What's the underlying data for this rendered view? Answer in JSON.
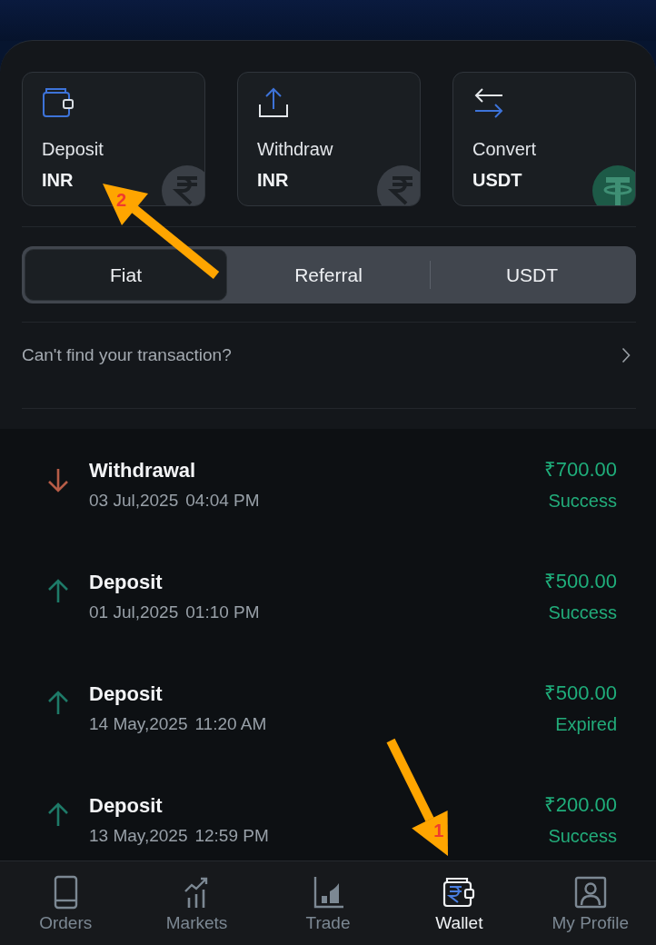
{
  "actions": [
    {
      "kind": "deposit",
      "label": "Deposit",
      "currency": "INR",
      "callout": "2"
    },
    {
      "kind": "withdraw",
      "label": "Withdraw",
      "currency": "INR"
    },
    {
      "kind": "convert",
      "label": "Convert",
      "currency": "USDT"
    }
  ],
  "tabs": [
    {
      "label": "Fiat",
      "selected": true
    },
    {
      "label": "Referral",
      "selected": false
    },
    {
      "label": "USDT",
      "selected": false
    }
  ],
  "help_link": {
    "label": "Can't find your transaction?"
  },
  "transactions": [
    {
      "kind": "withdrawal",
      "title": "Withdrawal",
      "date": "03 Jul,2025",
      "time": "04:04 PM",
      "amount": "₹700.00",
      "status": "Success"
    },
    {
      "kind": "deposit",
      "title": "Deposit",
      "date": "01 Jul,2025",
      "time": "01:10 PM",
      "amount": "₹500.00",
      "status": "Success"
    },
    {
      "kind": "deposit",
      "title": "Deposit",
      "date": "14 May,2025",
      "time": "11:20 AM",
      "amount": "₹500.00",
      "status": "Expired"
    },
    {
      "kind": "deposit",
      "title": "Deposit",
      "date": "13 May,2025",
      "time": "12:59 PM",
      "amount": "₹200.00",
      "status": "Success"
    }
  ],
  "bottom_nav": [
    {
      "kind": "orders",
      "label": "Orders",
      "selected": false
    },
    {
      "kind": "markets",
      "label": "Markets",
      "selected": false
    },
    {
      "kind": "trade",
      "label": "Trade",
      "selected": false
    },
    {
      "kind": "wallet",
      "label": "Wallet",
      "selected": true,
      "callout": "1"
    },
    {
      "kind": "profile",
      "label": "My Profile",
      "selected": false
    }
  ]
}
